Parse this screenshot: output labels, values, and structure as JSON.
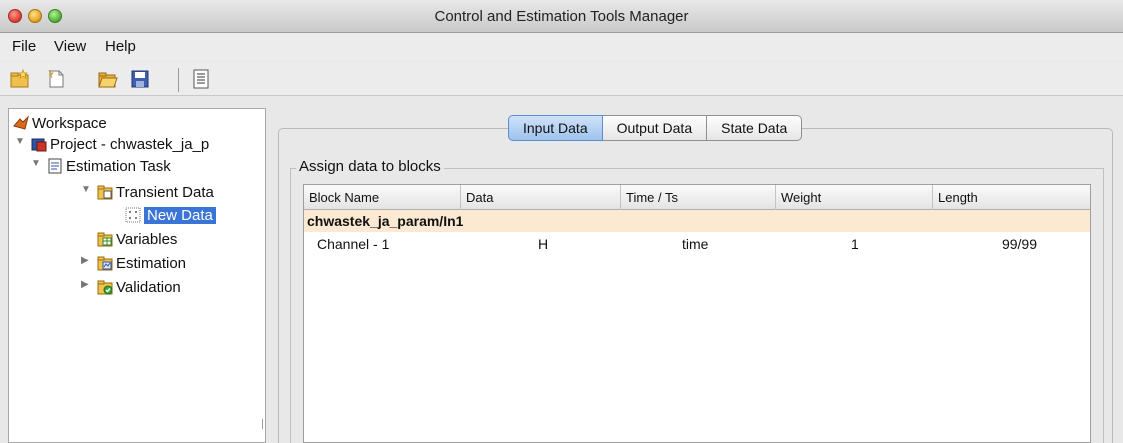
{
  "window": {
    "title": "Control and Estimation Tools Manager"
  },
  "menu": {
    "items": [
      "File",
      "View",
      "Help"
    ]
  },
  "toolbar": {
    "buttons": [
      {
        "icon": "new-project-icon"
      },
      {
        "icon": "new-task-icon"
      },
      {
        "icon": "open-folder-icon"
      },
      {
        "icon": "save-icon"
      },
      {
        "icon": "properties-icon"
      }
    ]
  },
  "tree": {
    "workspace": "Workspace",
    "project": "Project - chwastek_ja_p",
    "estimation_task": "Estimation Task",
    "transient_data": "Transient Data",
    "new_data": "New Data",
    "variables": "Variables",
    "estimation": "Estimation",
    "validation": "Validation"
  },
  "tabs": {
    "input": "Input Data",
    "output": "Output Data",
    "state": "State Data",
    "active": "Input Data"
  },
  "panel": {
    "group_title": "Assign data to blocks",
    "columns": [
      "Block Name",
      "Data",
      "Time / Ts",
      "Weight",
      "Length"
    ],
    "block_row": "chwastek_ja_param/In1",
    "channel_row": {
      "block_name": "Channel - 1",
      "data": "H",
      "time": "time",
      "weight": "1",
      "length": "99/99"
    }
  },
  "colors": {
    "selection": "#3b74d7",
    "tab_active": "#9ec3ee",
    "group_row": "#fbe9d1"
  }
}
